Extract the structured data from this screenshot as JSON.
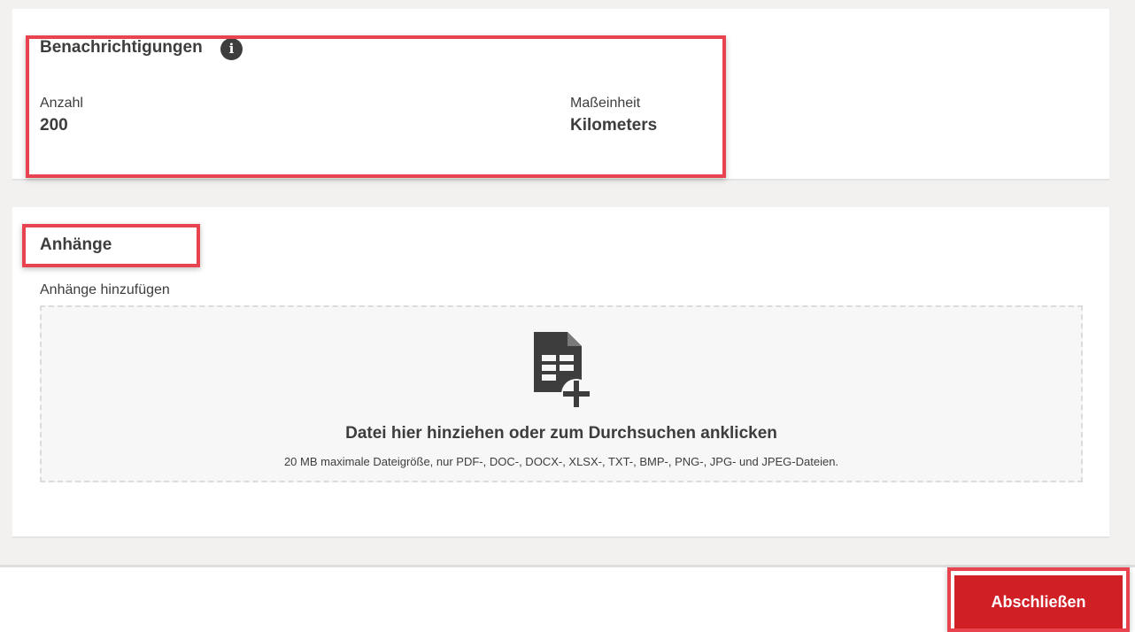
{
  "notifications": {
    "title": "Benachrichtigungen",
    "info_icon": "info-icon",
    "count_label": "Anzahl",
    "count_value": "200",
    "unit_label": "Maßeinheit",
    "unit_value": "Kilometers"
  },
  "attachments": {
    "title": "Anhänge",
    "add_label": "Anhänge hinzufügen",
    "dropzone": {
      "icon": "file-add-icon",
      "title": "Datei hier hinziehen oder zum Durchsuchen anklicken",
      "hint": "20 MB maximale Dateigröße, nur PDF-, DOC-, DOCX-, XLSX-, TXT-, BMP-, PNG-, JPG- und JPEG-Dateien."
    }
  },
  "footer": {
    "finish_label": "Abschließen"
  },
  "colors": {
    "accent": "#d11f26",
    "highlight": "#e8434f",
    "text": "#3d3d3d",
    "page_background": "#f2f1f0"
  }
}
